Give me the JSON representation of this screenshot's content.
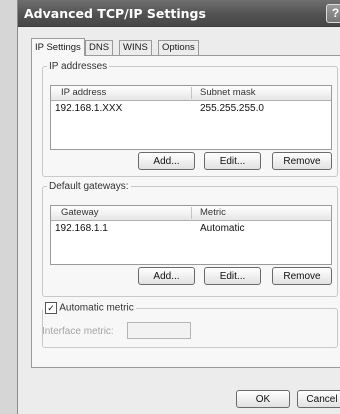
{
  "window": {
    "title": "Advanced TCP/IP Settings",
    "help_label": "?"
  },
  "tabs": [
    {
      "label": "IP Settings",
      "active": true
    },
    {
      "label": "DNS",
      "active": false
    },
    {
      "label": "WINS",
      "active": false
    },
    {
      "label": "Options",
      "active": false
    }
  ],
  "ip_addresses": {
    "legend": "IP addresses",
    "columns": [
      "IP address",
      "Subnet mask"
    ],
    "rows": [
      [
        "192.168.1.XXX",
        "255.255.255.0"
      ]
    ],
    "buttons": {
      "add": "Add...",
      "edit": "Edit...",
      "remove": "Remove"
    }
  },
  "default_gateways": {
    "legend": "Default gateways:",
    "columns": [
      "Gateway",
      "Metric"
    ],
    "rows": [
      [
        "192.168.1.1",
        "Automatic"
      ]
    ],
    "buttons": {
      "add": "Add...",
      "edit": "Edit...",
      "remove": "Remove"
    }
  },
  "metric": {
    "checkbox_label": "Automatic metric",
    "checked": true,
    "interface_metric_label": "Interface metric:",
    "interface_metric_value": ""
  },
  "footer": {
    "ok": "OK",
    "cancel": "Cancel"
  }
}
